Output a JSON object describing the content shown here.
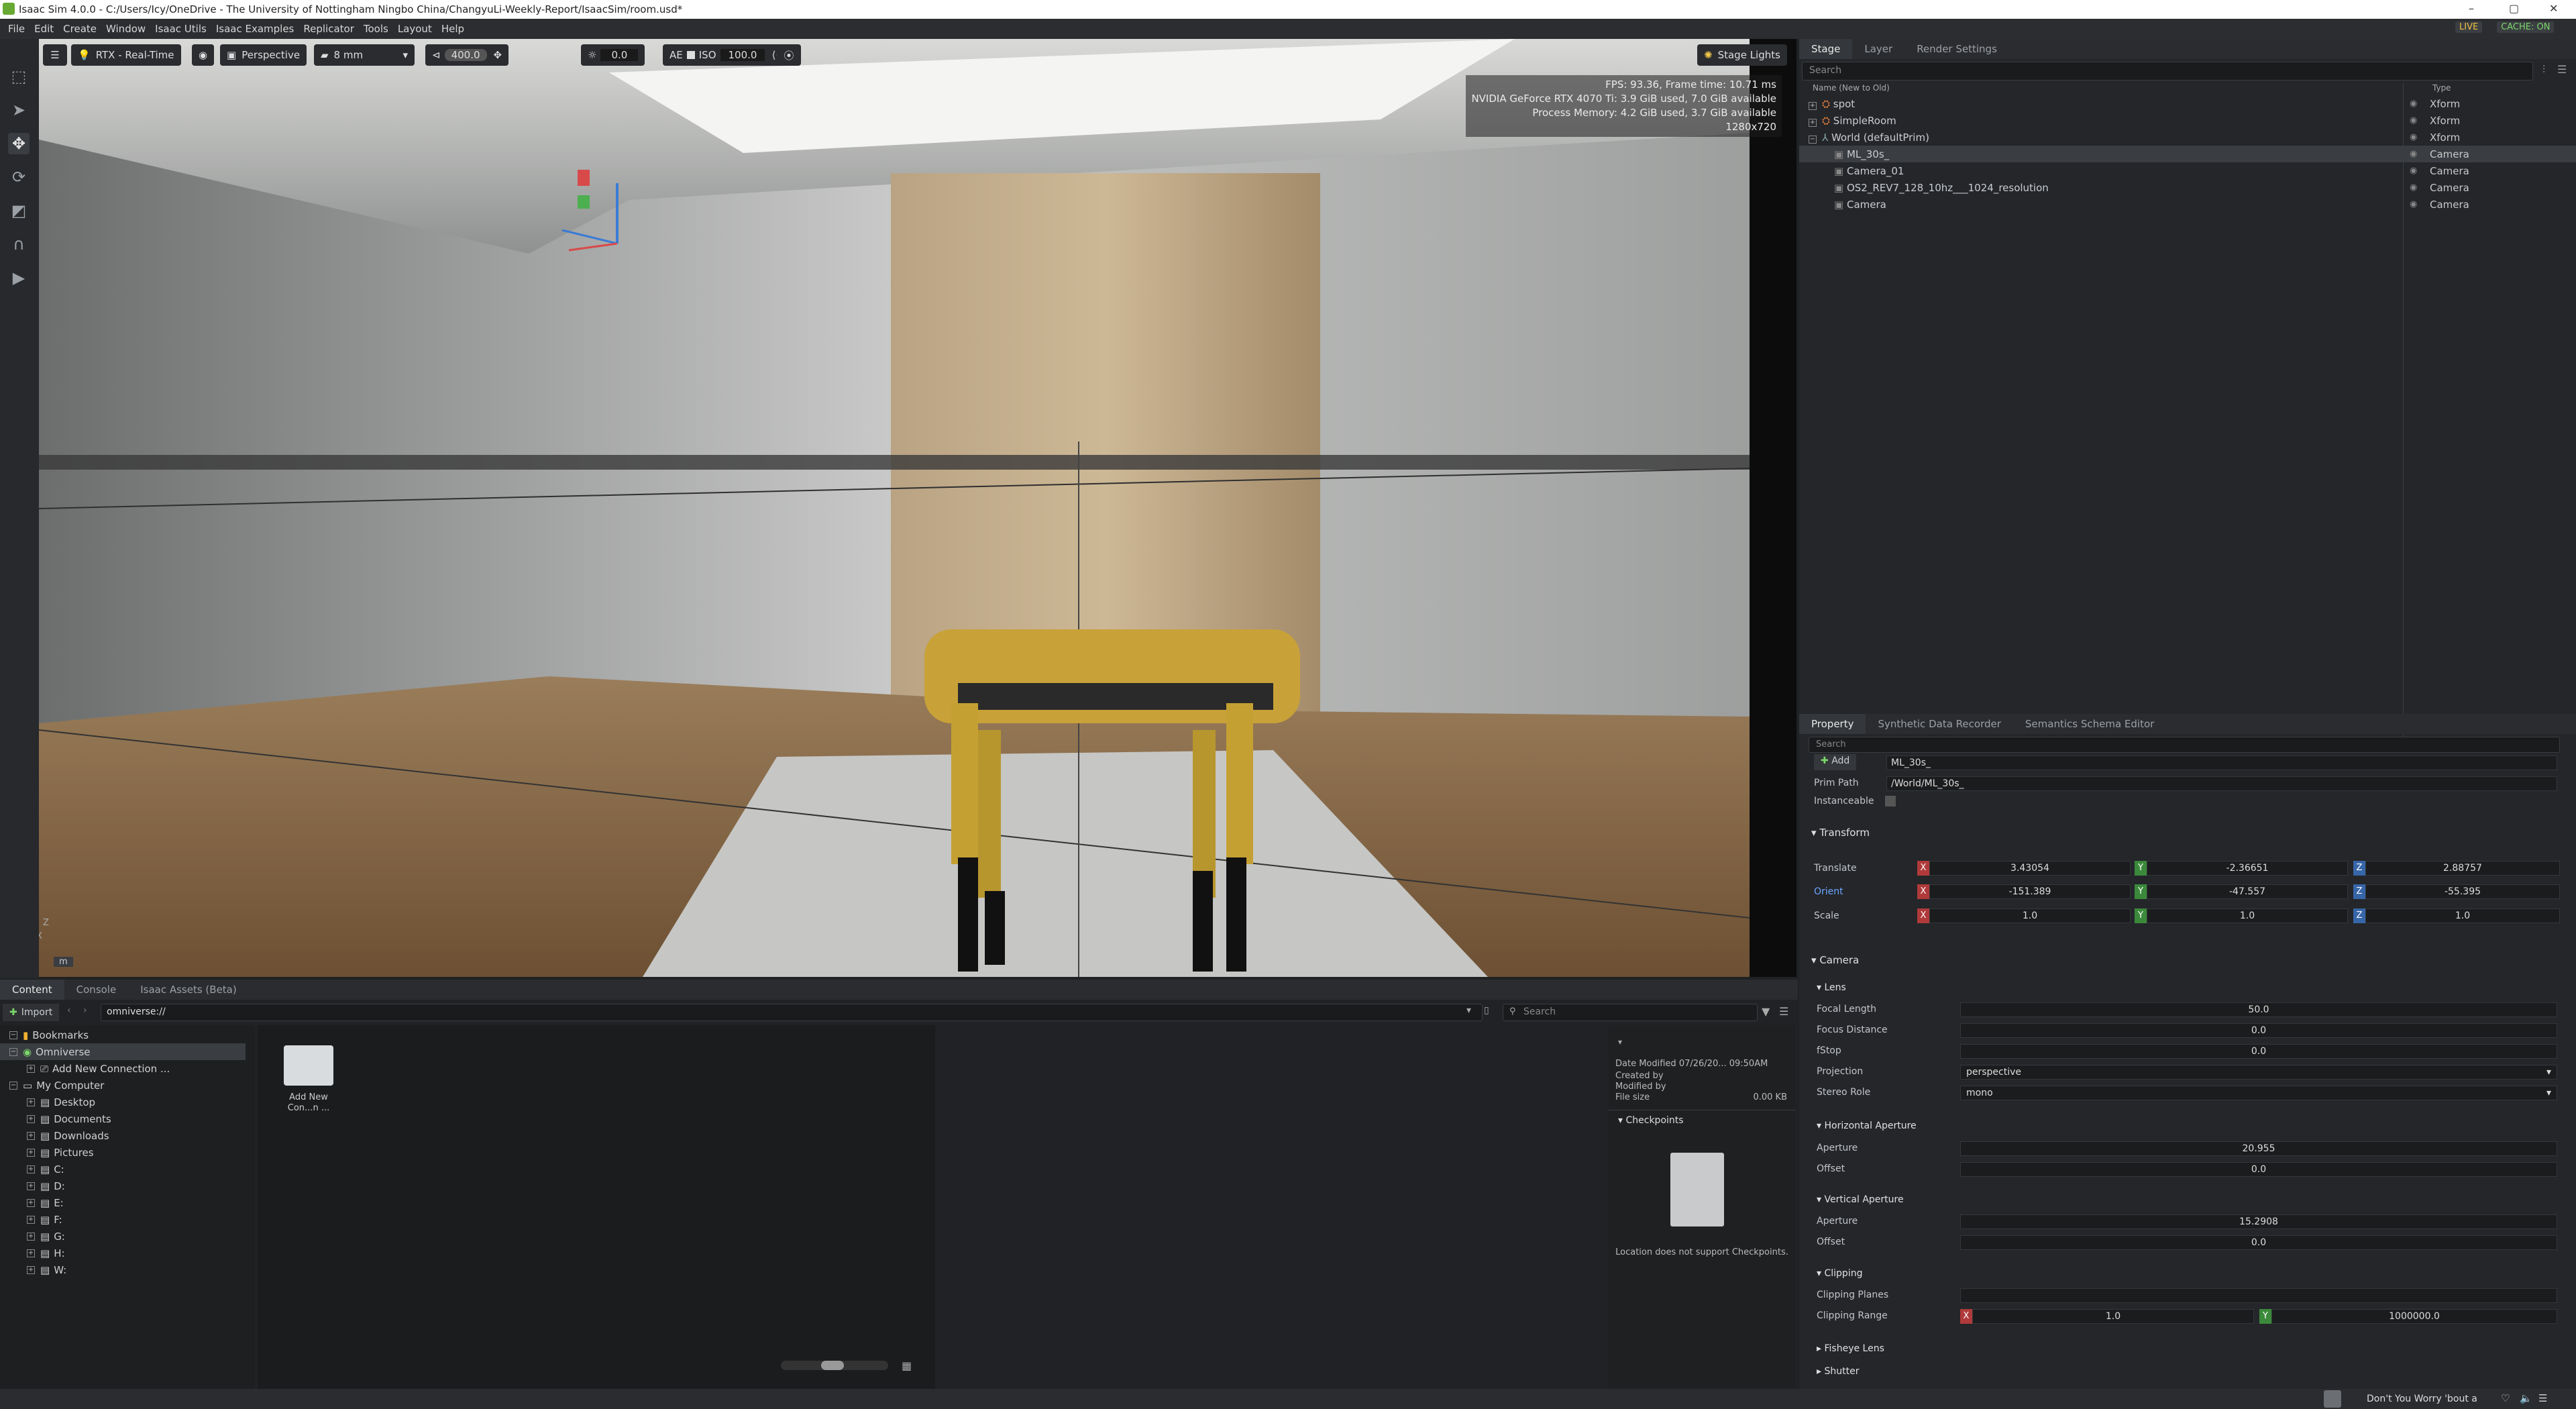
{
  "window": {
    "title": "Isaac Sim 4.0.0 - C:/Users/Icy/OneDrive - The University of Nottingham Ningbo China/ChangyuLi-Weekly-Report/IsaacSim/room.usd*",
    "min": "–",
    "max": "▢",
    "close": "✕"
  },
  "menu": [
    "File",
    "Edit",
    "Create",
    "Window",
    "Isaac Utils",
    "Isaac Examples",
    "Replicator",
    "Tools",
    "Layout",
    "Help"
  ],
  "live": {
    "live": "LIVE",
    "cache": "CACHE: ON"
  },
  "viewport": {
    "renderer": "RTX - Real-Time",
    "camera": "Perspective",
    "focal": "8 mm",
    "speed": "400.0",
    "exposure": "0.0",
    "ae": "AE",
    "iso_label": "ISO",
    "iso": "100.0",
    "stage_lights": "Stage Lights",
    "stats": [
      "FPS: 93.36, Frame time: 10.71 ms",
      "NVIDIA GeForce RTX 4070 Ti: 3.9 GiB used, 7.0 GiB available",
      "Process Memory: 4.2 GiB used, 3.7 GiB available",
      "1280x720"
    ],
    "unit": "m",
    "axis_z": "Z",
    "axis_x": "X"
  },
  "stage": {
    "tabs": [
      "Stage",
      "Layer",
      "Render Settings"
    ],
    "search": "Search",
    "col_name": "Name (New to Old)",
    "col_type": "Type",
    "rows": [
      {
        "name": "spot",
        "type": "Xform"
      },
      {
        "name": "SimpleRoom",
        "type": "Xform"
      },
      {
        "name": "World (defaultPrim)",
        "type": "Xform"
      },
      {
        "name": "ML_30s_",
        "type": "Camera"
      },
      {
        "name": "Camera_01",
        "type": "Camera"
      },
      {
        "name": "OS2_REV7_128_10hz___1024_resolution",
        "type": "Camera"
      },
      {
        "name": "Camera",
        "type": "Camera"
      }
    ]
  },
  "property": {
    "tabs": [
      "Property",
      "Synthetic Data Recorder",
      "Semantics Schema Editor"
    ],
    "search": "Search",
    "add": "Add",
    "prim_name": "ML_30s_",
    "prim_path_label": "Prim Path",
    "prim_path": "/World/ML_30s_",
    "instanceable": "Instanceable",
    "transform": "Transform",
    "translate_label": "Translate",
    "translate": [
      "3.43054",
      "-2.36651",
      "2.88757"
    ],
    "orient_label": "Orient",
    "orient": [
      "-151.389",
      "-47.557",
      "-55.395"
    ],
    "scale_label": "Scale",
    "scale": [
      "1.0",
      "1.0",
      "1.0"
    ],
    "camera": "Camera",
    "lens": "Lens",
    "focal_length_label": "Focal Length",
    "focal_length": "50.0",
    "focus_distance_label": "Focus Distance",
    "focus_distance": "0.0",
    "fstop_label": "fStop",
    "fstop": "0.0",
    "projection_label": "Projection",
    "projection": "perspective",
    "stereo_label": "Stereo Role",
    "stereo": "mono",
    "h_aperture": "Horizontal Aperture",
    "h_aperture_label": "Aperture",
    "h_aperture_val": "20.955",
    "h_offset_label": "Offset",
    "h_offset": "0.0",
    "v_aperture": "Vertical Aperture",
    "v_aperture_label": "Aperture",
    "v_aperture_val": "15.2908",
    "v_offset_label": "Offset",
    "v_offset": "0.0",
    "clipping": "Clipping",
    "clip_planes_label": "Clipping Planes",
    "clip_range_label": "Clipping Range",
    "clip_range": [
      "1.0",
      "1000000.0"
    ],
    "fisheye": "Fisheye Lens",
    "shutter": "Shutter"
  },
  "content": {
    "tabs": [
      "Content",
      "Console",
      "Isaac Assets (Beta)"
    ],
    "import": "Import",
    "path": "omniverse://",
    "search": "Search",
    "tree": [
      {
        "label": "Bookmarks",
        "indent": 0
      },
      {
        "label": "Omniverse",
        "indent": 0
      },
      {
        "label": "Add New Connection ...",
        "indent": 1
      },
      {
        "label": "My Computer",
        "indent": 0
      },
      {
        "label": "Desktop",
        "indent": 1
      },
      {
        "label": "Documents",
        "indent": 1
      },
      {
        "label": "Downloads",
        "indent": 1
      },
      {
        "label": "Pictures",
        "indent": 1
      },
      {
        "label": "C:",
        "indent": 1
      },
      {
        "label": "D:",
        "indent": 1
      },
      {
        "label": "E:",
        "indent": 1
      },
      {
        "label": "F:",
        "indent": 1
      },
      {
        "label": "G:",
        "indent": 1
      },
      {
        "label": "H:",
        "indent": 1
      },
      {
        "label": "W:",
        "indent": 1
      }
    ],
    "folder_label": "Add New Con...n ...",
    "info": {
      "date_modified_label": "Date Modified",
      "date_modified": "07/26/20... 09:50AM",
      "created_by": "Created by",
      "modified_by": "Modified by",
      "file_size_label": "File size",
      "file_size": "0.00 KB"
    },
    "checkpoints": "Checkpoints",
    "checkpoints_msg": "Location does not support Checkpoints."
  },
  "taskbar": {
    "song": "Don't You Worry 'bout a"
  }
}
